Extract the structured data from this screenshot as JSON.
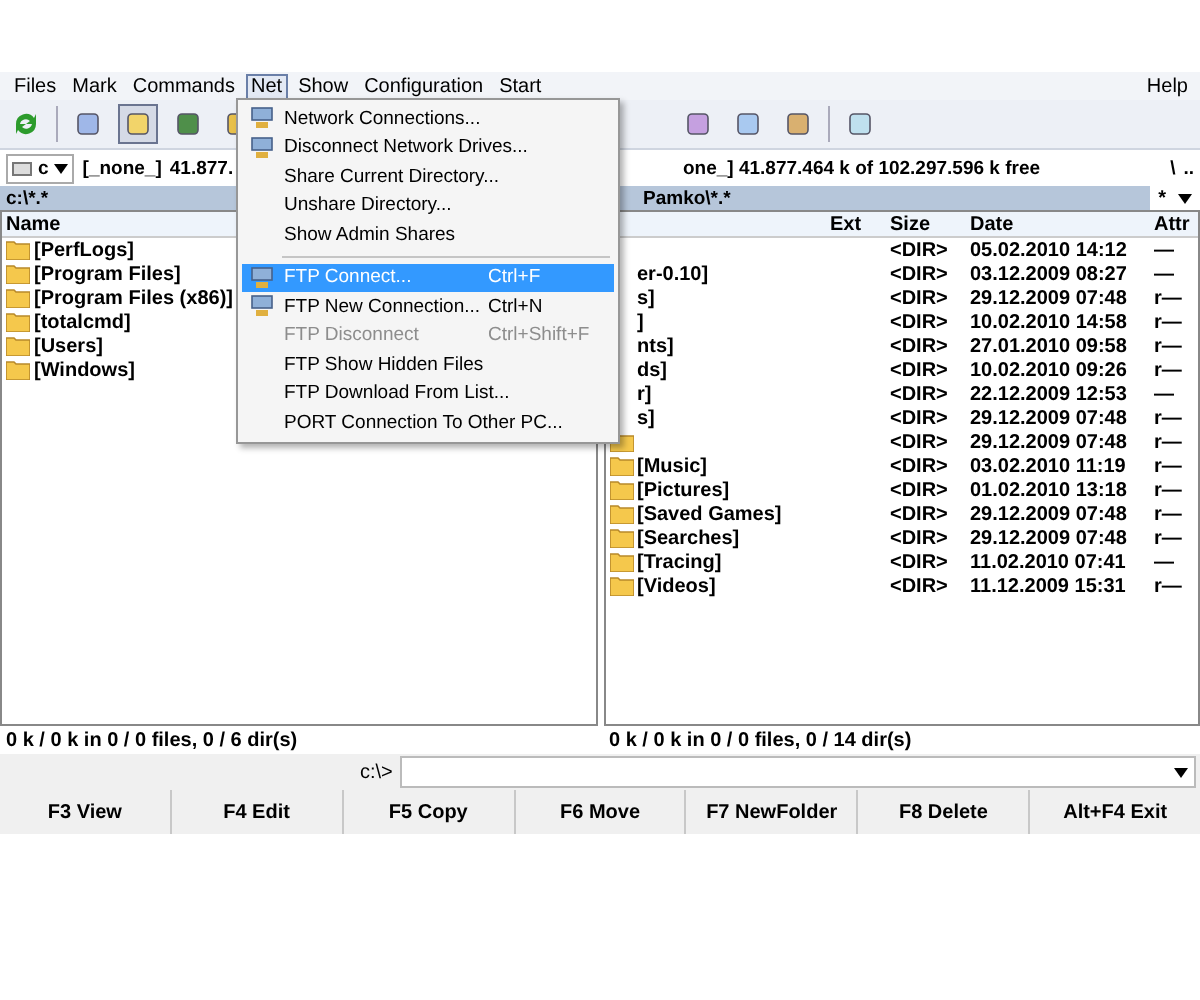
{
  "menubar": [
    {
      "label": "Files",
      "selected": false
    },
    {
      "label": "Mark",
      "selected": false
    },
    {
      "label": "Commands",
      "selected": false
    },
    {
      "label": "Net",
      "selected": true
    },
    {
      "label": "Show",
      "selected": false
    },
    {
      "label": "Configuration",
      "selected": false
    },
    {
      "label": "Start",
      "selected": false
    }
  ],
  "help": "Help",
  "left_panel": {
    "drive": "c",
    "volume": "[_none_]",
    "free": "41.877.",
    "path": "c:\\*.*",
    "columns": [
      "Name"
    ],
    "rows": [
      {
        "name": "[PerfLogs]"
      },
      {
        "name": "[Program Files]"
      },
      {
        "name": "[Program Files (x86)]"
      },
      {
        "name": "[totalcmd]"
      },
      {
        "name": "[Users]"
      },
      {
        "name": "[Windows]"
      }
    ],
    "status": "0 k / 0 k in 0 / 0 files, 0 / 6 dir(s)"
  },
  "right_panel": {
    "free": "one_]  41.877.464 k of 102.297.596 k free",
    "root": "\\",
    "up": "..",
    "path": "Pamko\\*.*",
    "filter": "*",
    "columns": [
      "Ext",
      "Size",
      "Date",
      "Attr"
    ],
    "rows": [
      {
        "icon": false,
        "size": "<DIR>",
        "date": "05.02.2010 14:12",
        "attr": "—"
      },
      {
        "icon": false,
        "name": "er-0.10]",
        "size": "<DIR>",
        "date": "03.12.2009 08:27",
        "attr": "—"
      },
      {
        "icon": false,
        "name": "s]",
        "size": "<DIR>",
        "date": "29.12.2009 07:48",
        "attr": "r—"
      },
      {
        "icon": false,
        "name": "]",
        "size": "<DIR>",
        "date": "10.02.2010 14:58",
        "attr": "r—"
      },
      {
        "icon": false,
        "name": "nts]",
        "size": "<DIR>",
        "date": "27.01.2010 09:58",
        "attr": "r—"
      },
      {
        "icon": false,
        "name": "ds]",
        "size": "<DIR>",
        "date": "10.02.2010 09:26",
        "attr": "r—"
      },
      {
        "icon": false,
        "name": "r]",
        "size": "<DIR>",
        "date": "22.12.2009 12:53",
        "attr": "—"
      },
      {
        "icon": false,
        "name": "s]",
        "size": "<DIR>",
        "date": "29.12.2009 07:48",
        "attr": "r—"
      },
      {
        "icon": true,
        "size": "<DIR>",
        "date": "29.12.2009 07:48",
        "attr": "r—"
      },
      {
        "icon": true,
        "name": "[Music]",
        "size": "<DIR>",
        "date": "03.02.2010 11:19",
        "attr": "r—"
      },
      {
        "icon": true,
        "name": "[Pictures]",
        "size": "<DIR>",
        "date": "01.02.2010 13:18",
        "attr": "r—"
      },
      {
        "icon": true,
        "name": "[Saved Games]",
        "size": "<DIR>",
        "date": "29.12.2009 07:48",
        "attr": "r—"
      },
      {
        "icon": true,
        "name": "[Searches]",
        "size": "<DIR>",
        "date": "29.12.2009 07:48",
        "attr": "r—"
      },
      {
        "icon": true,
        "name": "[Tracing]",
        "size": "<DIR>",
        "date": "11.02.2010 07:41",
        "attr": "—"
      },
      {
        "icon": true,
        "name": "[Videos]",
        "size": "<DIR>",
        "date": "11.12.2009 15:31",
        "attr": "r—"
      }
    ],
    "status": "0 k / 0 k in 0 / 0 files, 0 / 14 dir(s)"
  },
  "command_prompt": "c:\\>",
  "function_keys": [
    "F3 View",
    "F4 Edit",
    "F5 Copy",
    "F6 Move",
    "F7 NewFolder",
    "F8 Delete",
    "Alt+F4 Exit"
  ],
  "net_menu": [
    {
      "kind": "icon",
      "label": "Network Connections...",
      "disabled": false,
      "selected": false
    },
    {
      "kind": "icon",
      "label": "Disconnect Network Drives...",
      "disabled": false,
      "selected": false
    },
    {
      "kind": "item",
      "label": "Share Current Directory...",
      "disabled": false,
      "selected": false
    },
    {
      "kind": "item",
      "label": "Unshare Directory...",
      "disabled": false,
      "selected": false
    },
    {
      "kind": "item",
      "label": "Show Admin Shares",
      "disabled": false,
      "selected": false
    },
    {
      "kind": "separator"
    },
    {
      "kind": "icon",
      "label": "FTP Connect...",
      "shortcut": "Ctrl+F",
      "disabled": false,
      "selected": true
    },
    {
      "kind": "icon",
      "label": "FTP New Connection...",
      "shortcut": "Ctrl+N",
      "disabled": false,
      "selected": false
    },
    {
      "kind": "item",
      "label": "FTP Disconnect",
      "shortcut": "Ctrl+Shift+F",
      "disabled": true,
      "selected": false
    },
    {
      "kind": "item",
      "label": "FTP Show Hidden Files",
      "disabled": false,
      "selected": false
    },
    {
      "kind": "item",
      "label": "FTP Download From List...",
      "disabled": false,
      "selected": false
    },
    {
      "kind": "item",
      "label": "PORT Connection To Other PC...",
      "disabled": false,
      "selected": false
    }
  ]
}
